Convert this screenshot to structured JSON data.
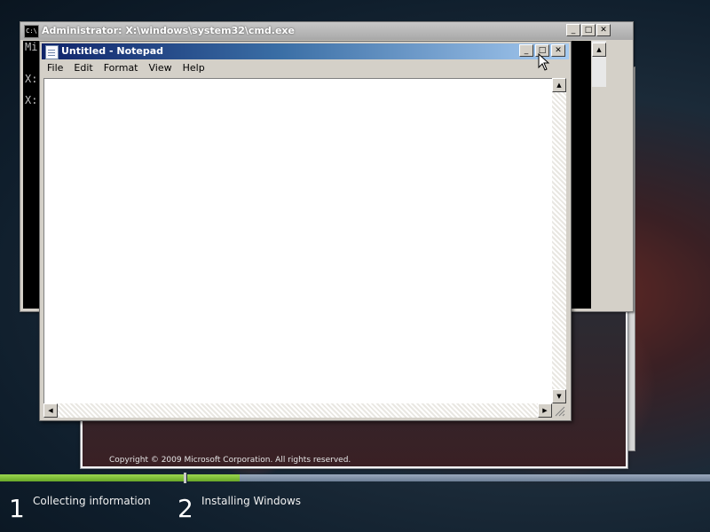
{
  "cmd_window": {
    "title": "Administrator: X:\\windows\\system32\\cmd.exe",
    "icon_text": "C:\\",
    "lines": [
      "Mi",
      "X:",
      "X:"
    ],
    "buttons": {
      "minimize": "_",
      "maximize": "□",
      "close": "✕"
    }
  },
  "notepad": {
    "title": "Untitled - Notepad",
    "menu": [
      "File",
      "Edit",
      "Format",
      "View",
      "Help"
    ],
    "content": "",
    "buttons": {
      "minimize": "_",
      "maximize": "□",
      "close": "✕"
    },
    "scroll": {
      "up": "▲",
      "down": "▼",
      "left": "◀",
      "right": "▶"
    }
  },
  "setup_window": {
    "copyright": "Copyright © 2009 Microsoft Corporation. All rights reserved.",
    "buttons": {
      "minimize": "_",
      "maximize": "□",
      "close": "✕"
    }
  },
  "progress": {
    "steps": [
      {
        "number": "1",
        "label": "Collecting information",
        "complete": 1.0
      },
      {
        "number": "2",
        "label": "Installing Windows",
        "complete": 0.1
      }
    ],
    "colors": {
      "done": "#7ab83a",
      "remaining": "#7f8fa6"
    }
  },
  "icons": [
    "cmd-icon",
    "notepad-icon",
    "mouse-pointer-icon",
    "resize-grip-icon"
  ]
}
